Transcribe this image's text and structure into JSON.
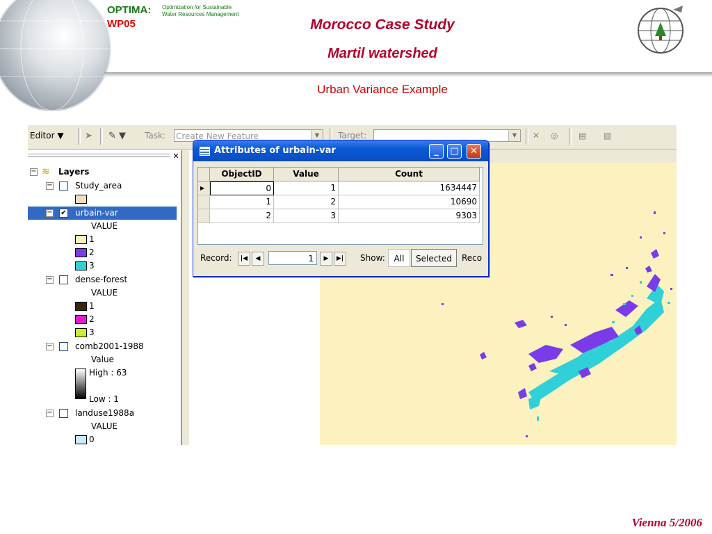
{
  "slide": {
    "brand": "OPTIMA:",
    "brand_sub_line1": "Optimization for Sustainable",
    "brand_sub_line2": "Water Resources Management",
    "work_package": "WP05",
    "title": "Morocco Case Study",
    "subtitle": "Martil watershed",
    "section": "Urban Variance Example",
    "footer": "Vienna 5/2006"
  },
  "toolbar": {
    "editor_label": "Editor",
    "task_label": "Task:",
    "task_value": "Create New Feature",
    "target_label": "Target:",
    "target_value": ""
  },
  "toc": {
    "root": "Layers",
    "layers": [
      {
        "name": "Study_area",
        "checked": false,
        "field": ""
      },
      {
        "name": "urbain-var",
        "checked": true,
        "field": "VALUE",
        "classes": [
          "1",
          "2",
          "3"
        ]
      },
      {
        "name": "dense-forest",
        "checked": false,
        "field": "VALUE",
        "classes": [
          "1",
          "2",
          "3"
        ]
      },
      {
        "name": "comb2001-1988",
        "checked": false,
        "field": "Value",
        "high": "High : 63",
        "low": "Low : 1"
      },
      {
        "name": "landuse1988a",
        "checked": false,
        "field": "VALUE",
        "classes": [
          "0"
        ]
      }
    ]
  },
  "colors": {
    "study_area": "#f2dcc2",
    "urb_1": "#fcf2bf",
    "urb_2": "#7a3ce8",
    "urb_3": "#30d0d8",
    "forest_1": "#3a2410",
    "forest_2": "#e818d0",
    "forest_3": "#c8f030",
    "landuse_0": "#c8ecfc",
    "map_background": "#fcf2bf"
  },
  "attributes": {
    "window_title": "Attributes of urbain-var",
    "columns": [
      "ObjectID",
      "Value",
      "Count"
    ],
    "rows": [
      [
        "0",
        "1",
        "1634447"
      ],
      [
        "1",
        "2",
        "10690"
      ],
      [
        "2",
        "3",
        "9303"
      ]
    ],
    "record_label": "Record:",
    "record_value": "1",
    "show_label": "Show:",
    "all_label": "All",
    "selected_label": "Selected",
    "records_label": "Reco"
  }
}
